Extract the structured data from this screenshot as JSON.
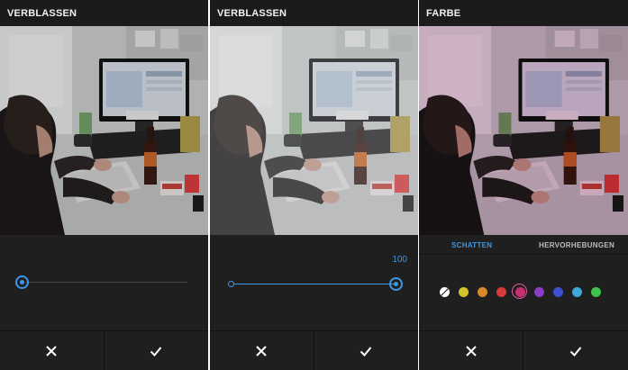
{
  "panels": [
    {
      "title": "VERBLASSEN",
      "slider_value": ""
    },
    {
      "title": "VERBLASSEN",
      "slider_value": "100"
    },
    {
      "title": "FARBE",
      "tabs": [
        "SCHATTEN",
        "HERVORHEBUNGEN"
      ],
      "active_tab": "SCHATTEN",
      "swatches": [
        "#ffffff",
        "#d4c32a",
        "#d68a28",
        "#d93a3a",
        "#c8306d",
        "#8c3dc8",
        "#3d4fd0",
        "#3ea9d9",
        "#3fc24a"
      ],
      "selected_swatch": "#c8306d"
    }
  ],
  "footer": {
    "cancel_icon": "close-icon",
    "confirm_icon": "check-icon"
  },
  "accent_color": "#3d96e6"
}
